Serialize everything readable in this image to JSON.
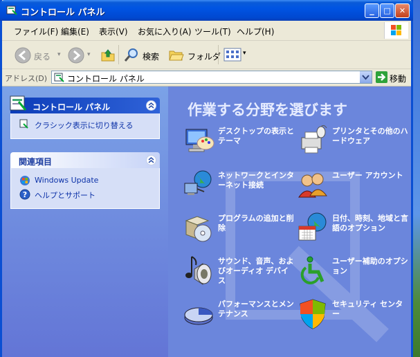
{
  "window": {
    "title": "コントロール パネル",
    "minimize": "_",
    "maximize": "□",
    "close": "✕"
  },
  "menu": [
    "ファイル(F)",
    "編集(E)",
    "表示(V)",
    "お気に入り(A)",
    "ツール(T)",
    "ヘルプ(H)"
  ],
  "toolbar": {
    "back": "戻る",
    "search": "検索",
    "folders": "フォルダ"
  },
  "address": {
    "label": "アドレス(D)",
    "value": "コントロール パネル",
    "go": "移動"
  },
  "sidebar": {
    "panel1": {
      "title": "コントロール パネル",
      "items": [
        "クラシック表示に切り替える"
      ]
    },
    "panel2": {
      "title": "関連項目",
      "items": [
        "Windows Update",
        "ヘルプとサポート"
      ]
    }
  },
  "main": {
    "title": "作業する分野を選びます",
    "categories": [
      {
        "label": "デスクトップの表示とテーマ",
        "icon": "desktop-icon"
      },
      {
        "label": "プリンタとその他のハードウェア",
        "icon": "printer-icon"
      },
      {
        "label": "ネットワークとインターネット接続",
        "icon": "network-icon"
      },
      {
        "label": "ユーザー アカウント",
        "icon": "users-icon"
      },
      {
        "label": "プログラムの追加と削除",
        "icon": "programs-icon"
      },
      {
        "label": "日付、時刻、地域と言語のオプション",
        "icon": "calendar-globe-icon"
      },
      {
        "label": "サウンド、音声、およびオーディオ デバイス",
        "icon": "sound-icon"
      },
      {
        "label": "ユーザー補助のオプション",
        "icon": "accessibility-icon"
      },
      {
        "label": "パフォーマンスとメンテナンス",
        "icon": "performance-icon"
      },
      {
        "label": "セキュリティ センター",
        "icon": "shield-icon"
      }
    ]
  }
}
